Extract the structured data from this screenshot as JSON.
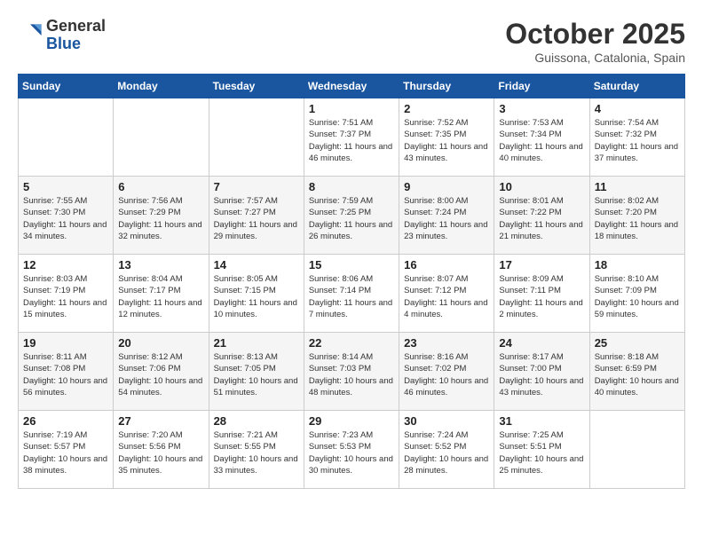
{
  "header": {
    "logo_line1": "General",
    "logo_line2": "Blue",
    "month": "October 2025",
    "location": "Guissona, Catalonia, Spain"
  },
  "days_of_week": [
    "Sunday",
    "Monday",
    "Tuesday",
    "Wednesday",
    "Thursday",
    "Friday",
    "Saturday"
  ],
  "weeks": [
    [
      {
        "day": "",
        "info": ""
      },
      {
        "day": "",
        "info": ""
      },
      {
        "day": "",
        "info": ""
      },
      {
        "day": "1",
        "info": "Sunrise: 7:51 AM\nSunset: 7:37 PM\nDaylight: 11 hours and 46 minutes."
      },
      {
        "day": "2",
        "info": "Sunrise: 7:52 AM\nSunset: 7:35 PM\nDaylight: 11 hours and 43 minutes."
      },
      {
        "day": "3",
        "info": "Sunrise: 7:53 AM\nSunset: 7:34 PM\nDaylight: 11 hours and 40 minutes."
      },
      {
        "day": "4",
        "info": "Sunrise: 7:54 AM\nSunset: 7:32 PM\nDaylight: 11 hours and 37 minutes."
      }
    ],
    [
      {
        "day": "5",
        "info": "Sunrise: 7:55 AM\nSunset: 7:30 PM\nDaylight: 11 hours and 34 minutes."
      },
      {
        "day": "6",
        "info": "Sunrise: 7:56 AM\nSunset: 7:29 PM\nDaylight: 11 hours and 32 minutes."
      },
      {
        "day": "7",
        "info": "Sunrise: 7:57 AM\nSunset: 7:27 PM\nDaylight: 11 hours and 29 minutes."
      },
      {
        "day": "8",
        "info": "Sunrise: 7:59 AM\nSunset: 7:25 PM\nDaylight: 11 hours and 26 minutes."
      },
      {
        "day": "9",
        "info": "Sunrise: 8:00 AM\nSunset: 7:24 PM\nDaylight: 11 hours and 23 minutes."
      },
      {
        "day": "10",
        "info": "Sunrise: 8:01 AM\nSunset: 7:22 PM\nDaylight: 11 hours and 21 minutes."
      },
      {
        "day": "11",
        "info": "Sunrise: 8:02 AM\nSunset: 7:20 PM\nDaylight: 11 hours and 18 minutes."
      }
    ],
    [
      {
        "day": "12",
        "info": "Sunrise: 8:03 AM\nSunset: 7:19 PM\nDaylight: 11 hours and 15 minutes."
      },
      {
        "day": "13",
        "info": "Sunrise: 8:04 AM\nSunset: 7:17 PM\nDaylight: 11 hours and 12 minutes."
      },
      {
        "day": "14",
        "info": "Sunrise: 8:05 AM\nSunset: 7:15 PM\nDaylight: 11 hours and 10 minutes."
      },
      {
        "day": "15",
        "info": "Sunrise: 8:06 AM\nSunset: 7:14 PM\nDaylight: 11 hours and 7 minutes."
      },
      {
        "day": "16",
        "info": "Sunrise: 8:07 AM\nSunset: 7:12 PM\nDaylight: 11 hours and 4 minutes."
      },
      {
        "day": "17",
        "info": "Sunrise: 8:09 AM\nSunset: 7:11 PM\nDaylight: 11 hours and 2 minutes."
      },
      {
        "day": "18",
        "info": "Sunrise: 8:10 AM\nSunset: 7:09 PM\nDaylight: 10 hours and 59 minutes."
      }
    ],
    [
      {
        "day": "19",
        "info": "Sunrise: 8:11 AM\nSunset: 7:08 PM\nDaylight: 10 hours and 56 minutes."
      },
      {
        "day": "20",
        "info": "Sunrise: 8:12 AM\nSunset: 7:06 PM\nDaylight: 10 hours and 54 minutes."
      },
      {
        "day": "21",
        "info": "Sunrise: 8:13 AM\nSunset: 7:05 PM\nDaylight: 10 hours and 51 minutes."
      },
      {
        "day": "22",
        "info": "Sunrise: 8:14 AM\nSunset: 7:03 PM\nDaylight: 10 hours and 48 minutes."
      },
      {
        "day": "23",
        "info": "Sunrise: 8:16 AM\nSunset: 7:02 PM\nDaylight: 10 hours and 46 minutes."
      },
      {
        "day": "24",
        "info": "Sunrise: 8:17 AM\nSunset: 7:00 PM\nDaylight: 10 hours and 43 minutes."
      },
      {
        "day": "25",
        "info": "Sunrise: 8:18 AM\nSunset: 6:59 PM\nDaylight: 10 hours and 40 minutes."
      }
    ],
    [
      {
        "day": "26",
        "info": "Sunrise: 7:19 AM\nSunset: 5:57 PM\nDaylight: 10 hours and 38 minutes."
      },
      {
        "day": "27",
        "info": "Sunrise: 7:20 AM\nSunset: 5:56 PM\nDaylight: 10 hours and 35 minutes."
      },
      {
        "day": "28",
        "info": "Sunrise: 7:21 AM\nSunset: 5:55 PM\nDaylight: 10 hours and 33 minutes."
      },
      {
        "day": "29",
        "info": "Sunrise: 7:23 AM\nSunset: 5:53 PM\nDaylight: 10 hours and 30 minutes."
      },
      {
        "day": "30",
        "info": "Sunrise: 7:24 AM\nSunset: 5:52 PM\nDaylight: 10 hours and 28 minutes."
      },
      {
        "day": "31",
        "info": "Sunrise: 7:25 AM\nSunset: 5:51 PM\nDaylight: 10 hours and 25 minutes."
      },
      {
        "day": "",
        "info": ""
      }
    ]
  ]
}
